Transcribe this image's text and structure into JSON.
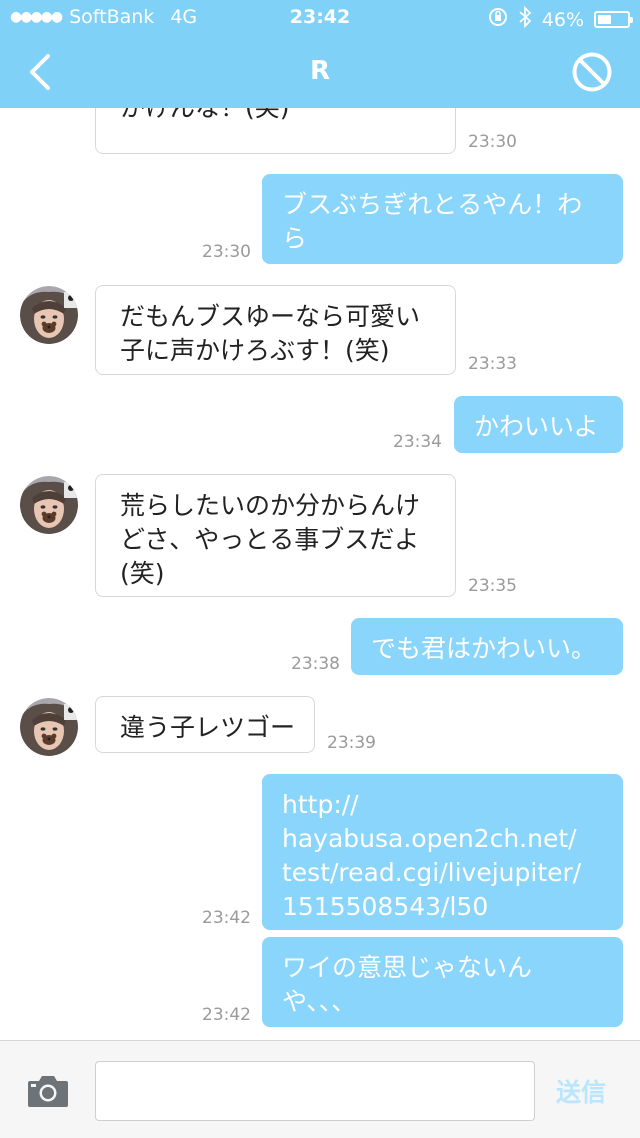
{
  "status_bar": {
    "carrier": "SoftBank",
    "network": "4G",
    "time": "23:42",
    "battery_percent": "46%",
    "battery_level": 0.46
  },
  "nav": {
    "title": "R",
    "back_icon": "chevron-left-icon",
    "block_icon": "block-icon"
  },
  "messages": [
    {
      "dir": "in",
      "lines": [
        "かけんな！(笑)"
      ],
      "time": "23:30"
    },
    {
      "dir": "out",
      "lines": [
        "ブスぶちぎれとるやん！わ",
        "ら"
      ],
      "time": "23:30"
    },
    {
      "dir": "in",
      "lines": [
        "だもんブスゆーなら可愛い",
        "子に声かけろぶす！(笑)"
      ],
      "time": "23:33"
    },
    {
      "dir": "out",
      "lines": [
        "かわいいよ"
      ],
      "time": "23:34"
    },
    {
      "dir": "in",
      "lines": [
        "荒らしたいのか分からんけ",
        "どさ、やっとる事ブスだよ",
        "(笑)"
      ],
      "time": "23:35"
    },
    {
      "dir": "out",
      "lines": [
        "でも君はかわいい。"
      ],
      "time": "23:38"
    },
    {
      "dir": "in",
      "lines": [
        "違う子レツゴー"
      ],
      "time": "23:39"
    },
    {
      "dir": "out",
      "lines": [
        "http://",
        "hayabusa.open2ch.net/",
        "test/read.cgi/livejupiter/",
        "1515508543/l50"
      ],
      "time": "23:42"
    },
    {
      "dir": "out",
      "lines": [
        "ワイの意思じゃないん",
        "や、、、"
      ],
      "time": "23:42"
    }
  ],
  "footer": {
    "camera_icon": "camera-icon",
    "input_value": "",
    "input_placeholder": "",
    "send_label": "送信"
  },
  "colors": {
    "header": "#7fd1f7",
    "outgoing_bubble": "#8ad5fb",
    "send_disabled": "#b9e6fc"
  }
}
